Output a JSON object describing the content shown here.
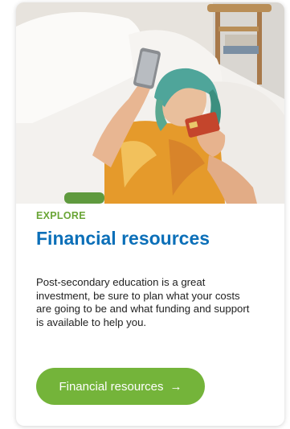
{
  "card": {
    "eyebrow": "EXPLORE",
    "title": "Financial resources",
    "description": "Post-secondary education is a great investment, be sure to plan what your costs are going to be and what funding and support is available to help you.",
    "button_label": "Financial resources",
    "button_icon": "arrow-right-icon",
    "photo_subject": "photo"
  },
  "colors": {
    "eyebrow": "#6aa536",
    "title": "#0b6fb8",
    "button": "#74b43a",
    "button_text": "#ffffff",
    "body_text": "#222222"
  }
}
